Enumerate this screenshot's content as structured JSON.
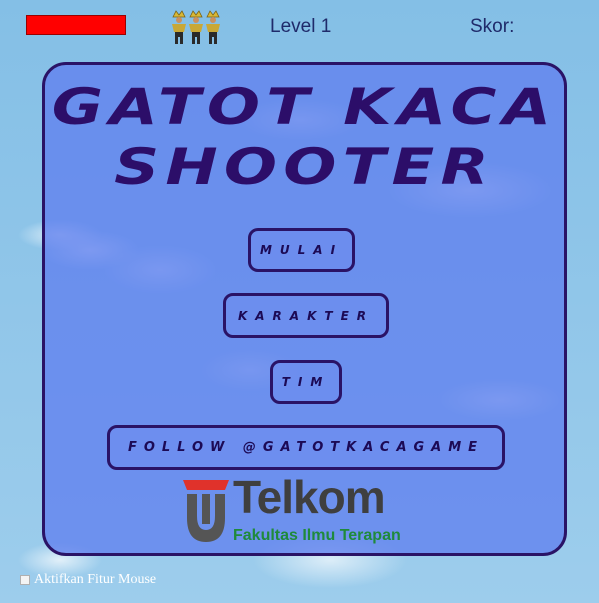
{
  "hud": {
    "health": 1.0,
    "health_color": "#ff0000",
    "lives": 3,
    "life_icon": "gatotkaca-icon",
    "level_label": "Level 1",
    "score_label": "Skor:"
  },
  "menu": {
    "title_line1": "GATOT KACA",
    "title_line2": "SHOOTER",
    "buttons": {
      "mulai": "MULAI",
      "karakter": "KARAKTER",
      "tim": "TIM",
      "follow": "FOLLOW @GATOTKACAGAME"
    }
  },
  "logo": {
    "wordmark": "Telkom",
    "subtitle": "Fakultas Ilmu Terapan",
    "accent_red": "#e0322b",
    "accent_gray": "#555555",
    "accent_green": "#1f8a3b"
  },
  "footer": {
    "mouse_option_label": "Aktifkan Fitur Mouse",
    "mouse_option_checked": false
  },
  "colors": {
    "panel_border": "#2a1366",
    "title_text": "#2c0e69",
    "hud_text": "#1f2a6a"
  }
}
